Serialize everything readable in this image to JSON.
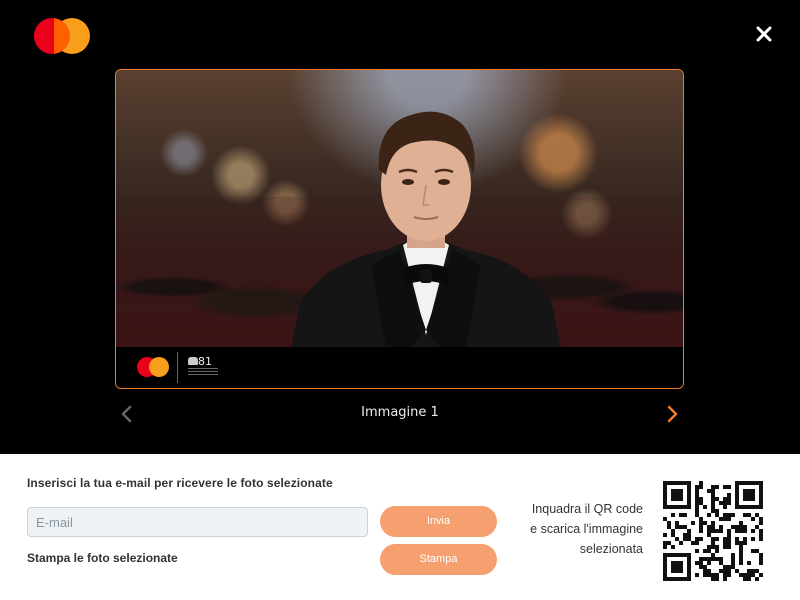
{
  "header": {
    "logo_icon": "mastercard-logo",
    "close_icon": "close-icon"
  },
  "photo": {
    "caption": "Immagine 1",
    "bar_logo": "mastercard-logo",
    "bar_event_logo": "venice-film-festival-81-logo"
  },
  "form": {
    "email_heading": "Inserisci la tua e-mail per ricevere le foto selezionate",
    "email_placeholder": "E-mail",
    "email_value": "",
    "send_label": "Invia",
    "print_heading": "Stampa le foto selezionate",
    "print_label": "Stampa"
  },
  "qr": {
    "text_line1": "Inquadra il QR code",
    "text_line2": "e scarica l'immagine",
    "text_line3": "selezionata"
  },
  "colors": {
    "accent": "#f07a2e",
    "button": "#f5a06e",
    "mastercard_red": "#eb001b",
    "mastercard_yellow": "#f79e1b"
  }
}
